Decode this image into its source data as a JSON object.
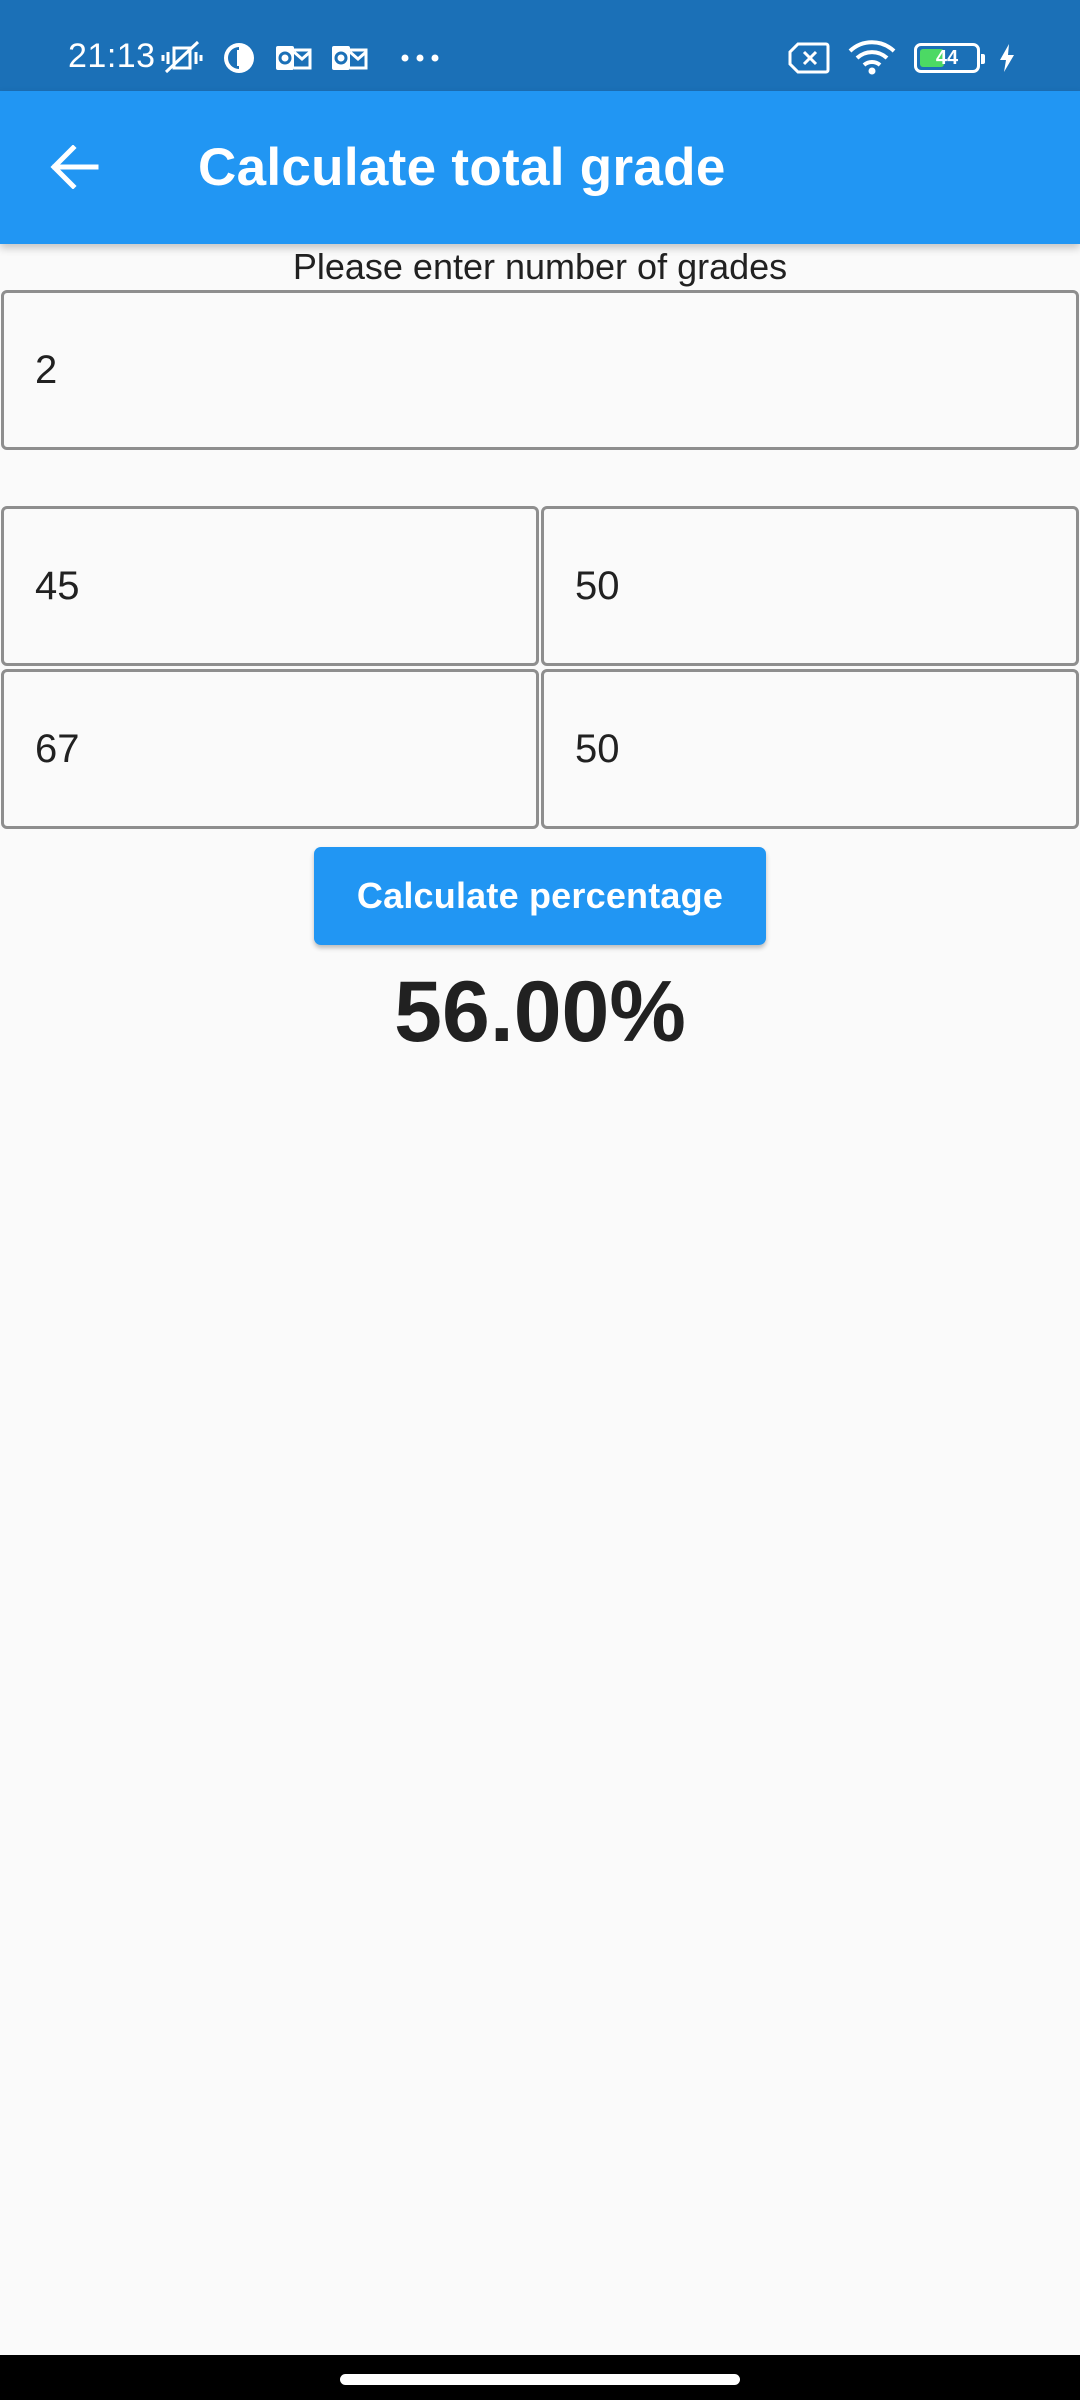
{
  "status_bar": {
    "time": "21:13",
    "battery_level": "44",
    "battery_fraction": 0.44,
    "left_icons": [
      "vibrate-off-icon",
      "app-notification-icon",
      "outlook-icon",
      "outlook-icon",
      "more-dots-icon"
    ],
    "right_icons": [
      "sim-error-icon",
      "wifi-icon",
      "battery-icon",
      "charging-icon"
    ],
    "background_color": "#1b70b7"
  },
  "app_bar": {
    "title": "Calculate total grade",
    "back_icon": "arrow-back-icon",
    "background_color": "#2196f3"
  },
  "form": {
    "count_label": "Please enter number of grades",
    "count_value": "2",
    "grades": [
      [
        "45",
        "50"
      ],
      [
        "67",
        "50"
      ]
    ]
  },
  "actions": {
    "calculate_label": "Calculate percentage"
  },
  "result": {
    "percentage": "56.00%"
  }
}
